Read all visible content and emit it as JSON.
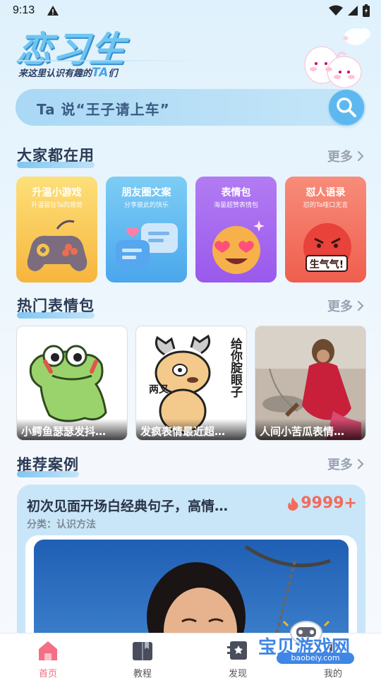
{
  "status_bar": {
    "time": "9:13"
  },
  "header": {
    "app_name": "恋习生",
    "slogan_prefix": "来这里认识有趣的",
    "slogan_ta": "TA",
    "slogan_suffix": "们"
  },
  "search": {
    "placeholder": "Ta 说“王子请上车”"
  },
  "sections": {
    "popular": {
      "title": "大家都在用",
      "more": "更多"
    },
    "stickers": {
      "title": "热门表情包",
      "more": "更多"
    },
    "cases": {
      "title": "推荐案例",
      "more": "更多"
    }
  },
  "categories": [
    {
      "title": "升温小游戏",
      "subtitle": "升温留住Ta的感情",
      "color_top": "#fde07a",
      "color_bottom": "#f7b53c"
    },
    {
      "title": "朋友圈文案",
      "subtitle": "分享彼此的快乐",
      "color_top": "#7dcdf5",
      "color_bottom": "#4aa7ec"
    },
    {
      "title": "表情包",
      "subtitle": "海量超赞表情包",
      "color_top": "#b27cf3",
      "color_bottom": "#9a59ec"
    },
    {
      "title": "怼人语录",
      "subtitle": "怼的Ta哑口无言",
      "color_top": "#f88c7a",
      "color_bottom": "#ef5e4e"
    }
  ],
  "category_art": {
    "angry_text": "生气气!"
  },
  "stickers": [
    {
      "label": "小鳄鱼瑟瑟发抖…"
    },
    {
      "label": "发疯表情最近超…",
      "art_text_left": "两叉",
      "art_text_right": "给你腚眼子"
    },
    {
      "label": "人间小苦瓜表情…"
    }
  ],
  "case": {
    "title": "初次见面开场白经典句子，高情…",
    "hot": "9999+",
    "category": "分类：认识方法"
  },
  "nav": [
    {
      "label": "首页",
      "active": true
    },
    {
      "label": "教程",
      "active": false
    },
    {
      "label": "发现",
      "active": false
    },
    {
      "label": "我的",
      "active": false
    }
  ],
  "watermark": {
    "text": "宝贝游戏网",
    "url": "baobeiy.com"
  },
  "colors": {
    "accent": "#5db8f0",
    "nav_active": "#f06b80",
    "hot": "#f26b5b"
  }
}
